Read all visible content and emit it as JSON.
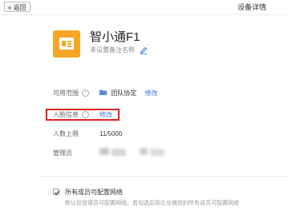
{
  "header": {
    "back_label": "« 返回",
    "title": "设备详情"
  },
  "device": {
    "icon": "device-terminal-icon",
    "name": "智小通F1",
    "remark_placeholder": "未设置备注名称",
    "edit_icon": "pencil-icon"
  },
  "info": {
    "scope_label": "可用范围",
    "scope_value": "团队协定",
    "scope_action": "修改",
    "face_label": "人脸信息",
    "face_action": "修改",
    "limit_label": "人数上限",
    "limit_value": "11/5000",
    "admin_label": "管理员",
    "help_icon": "help-circle-icon",
    "folder_icon": "folder-icon"
  },
  "network": {
    "checked": true,
    "label": "所有成员可配置网络",
    "description": "默认仅管理员可配置网络，若勾选后则企业微信的所有成员可配置网络"
  },
  "colors": {
    "accent": "#3a76d9",
    "device_icon": "#f5a623",
    "highlight": "#e02020"
  }
}
